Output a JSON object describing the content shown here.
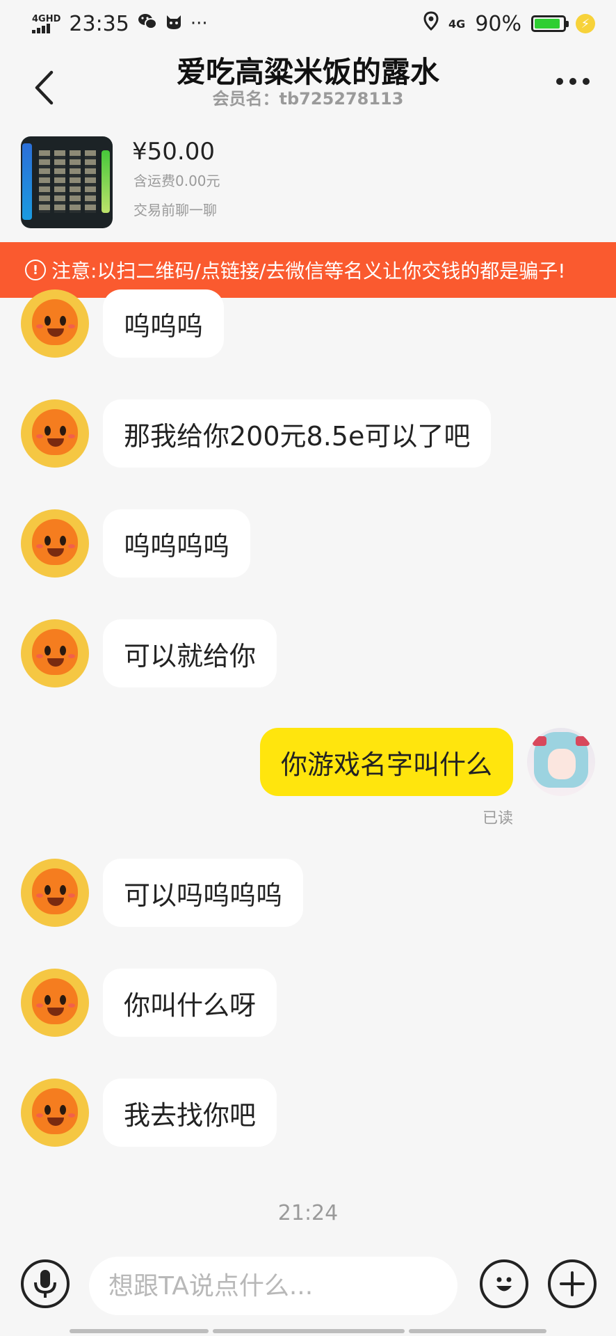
{
  "status_bar": {
    "network": "4GHD",
    "time": "23:35",
    "notification_icons": [
      "wechat-icon",
      "app-icon",
      "more-notifications"
    ],
    "more_glyph": "···",
    "net_type": "4G",
    "battery_percent": "90%",
    "battery_level": 0.9,
    "battery_color": "#2fce32"
  },
  "header": {
    "back_icon": "chevron-left-icon",
    "title": "爱吃高粱米饭的露水",
    "subtitle": "会员名：tb725278113",
    "more_icon": "more-dots-icon"
  },
  "product": {
    "price": "¥50.00",
    "shipping": "含运费0.00元",
    "chat_note": "交易前聊一聊"
  },
  "warning": {
    "icon": "!",
    "text": "注意:以扫二维码/点链接/去微信等名义让你交钱的都是骗子!",
    "color": "#fa5a2f"
  },
  "messages": [
    {
      "sender": "other",
      "text": "呜呜呜"
    },
    {
      "sender": "other",
      "text": "那我给你200元8.5e可以了吧"
    },
    {
      "sender": "other",
      "text": "呜呜呜呜"
    },
    {
      "sender": "other",
      "text": "可以就给你"
    },
    {
      "sender": "me",
      "text": "你游戏名字叫什么",
      "status": "已读"
    },
    {
      "sender": "other",
      "text": "可以吗呜呜呜"
    },
    {
      "sender": "other",
      "text": "你叫什么呀"
    },
    {
      "sender": "other",
      "text": "我去找你吧"
    }
  ],
  "timestamp": "21:24",
  "input": {
    "placeholder": "想跟TA说点什么...",
    "voice_icon": "microphone-icon",
    "emoji_icon": "emoji-icon",
    "add_icon": "plus-icon"
  },
  "colors": {
    "my_bubble": "#ffe50d",
    "other_bubble": "#ffffff",
    "background": "#f6f6f6"
  }
}
